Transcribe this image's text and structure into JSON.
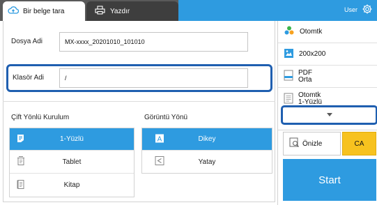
{
  "tabs": {
    "scan_label": "Bir belge tara",
    "print_label": "Yazdır"
  },
  "header": {
    "user_label": "User"
  },
  "form": {
    "file_name_label": "Dosya Adi",
    "file_name_value": "MX-xxxx_20201010_101010",
    "folder_name_label": "Klasör Adi",
    "folder_name_value": "/"
  },
  "duplex": {
    "title": "Çift Yönlü Kurulum",
    "options": [
      {
        "label": "1-Yüzlü",
        "selected": true
      },
      {
        "label": "Tablet",
        "selected": false
      },
      {
        "label": "Kitap",
        "selected": false
      }
    ]
  },
  "orientation": {
    "title": "Görüntü Yönü",
    "options": [
      {
        "label": "Dikey",
        "selected": true
      },
      {
        "label": "Yatay",
        "selected": false
      }
    ]
  },
  "settings": {
    "color_mode": "Otomtk",
    "resolution": "200x200",
    "format_line1": "PDF",
    "format_line2": "Orta",
    "sides_line1": "Otomtk",
    "sides_line2": "1-Yüzlü"
  },
  "actions": {
    "preview_label": "Önizle",
    "ca_label": "CA",
    "start_label": "Start"
  },
  "colors": {
    "accent_blue": "#2e9be0",
    "highlight_border": "#1f5fb0",
    "ca_yellow": "#f7c21f",
    "topbar_gray": "#5a5a5a"
  }
}
